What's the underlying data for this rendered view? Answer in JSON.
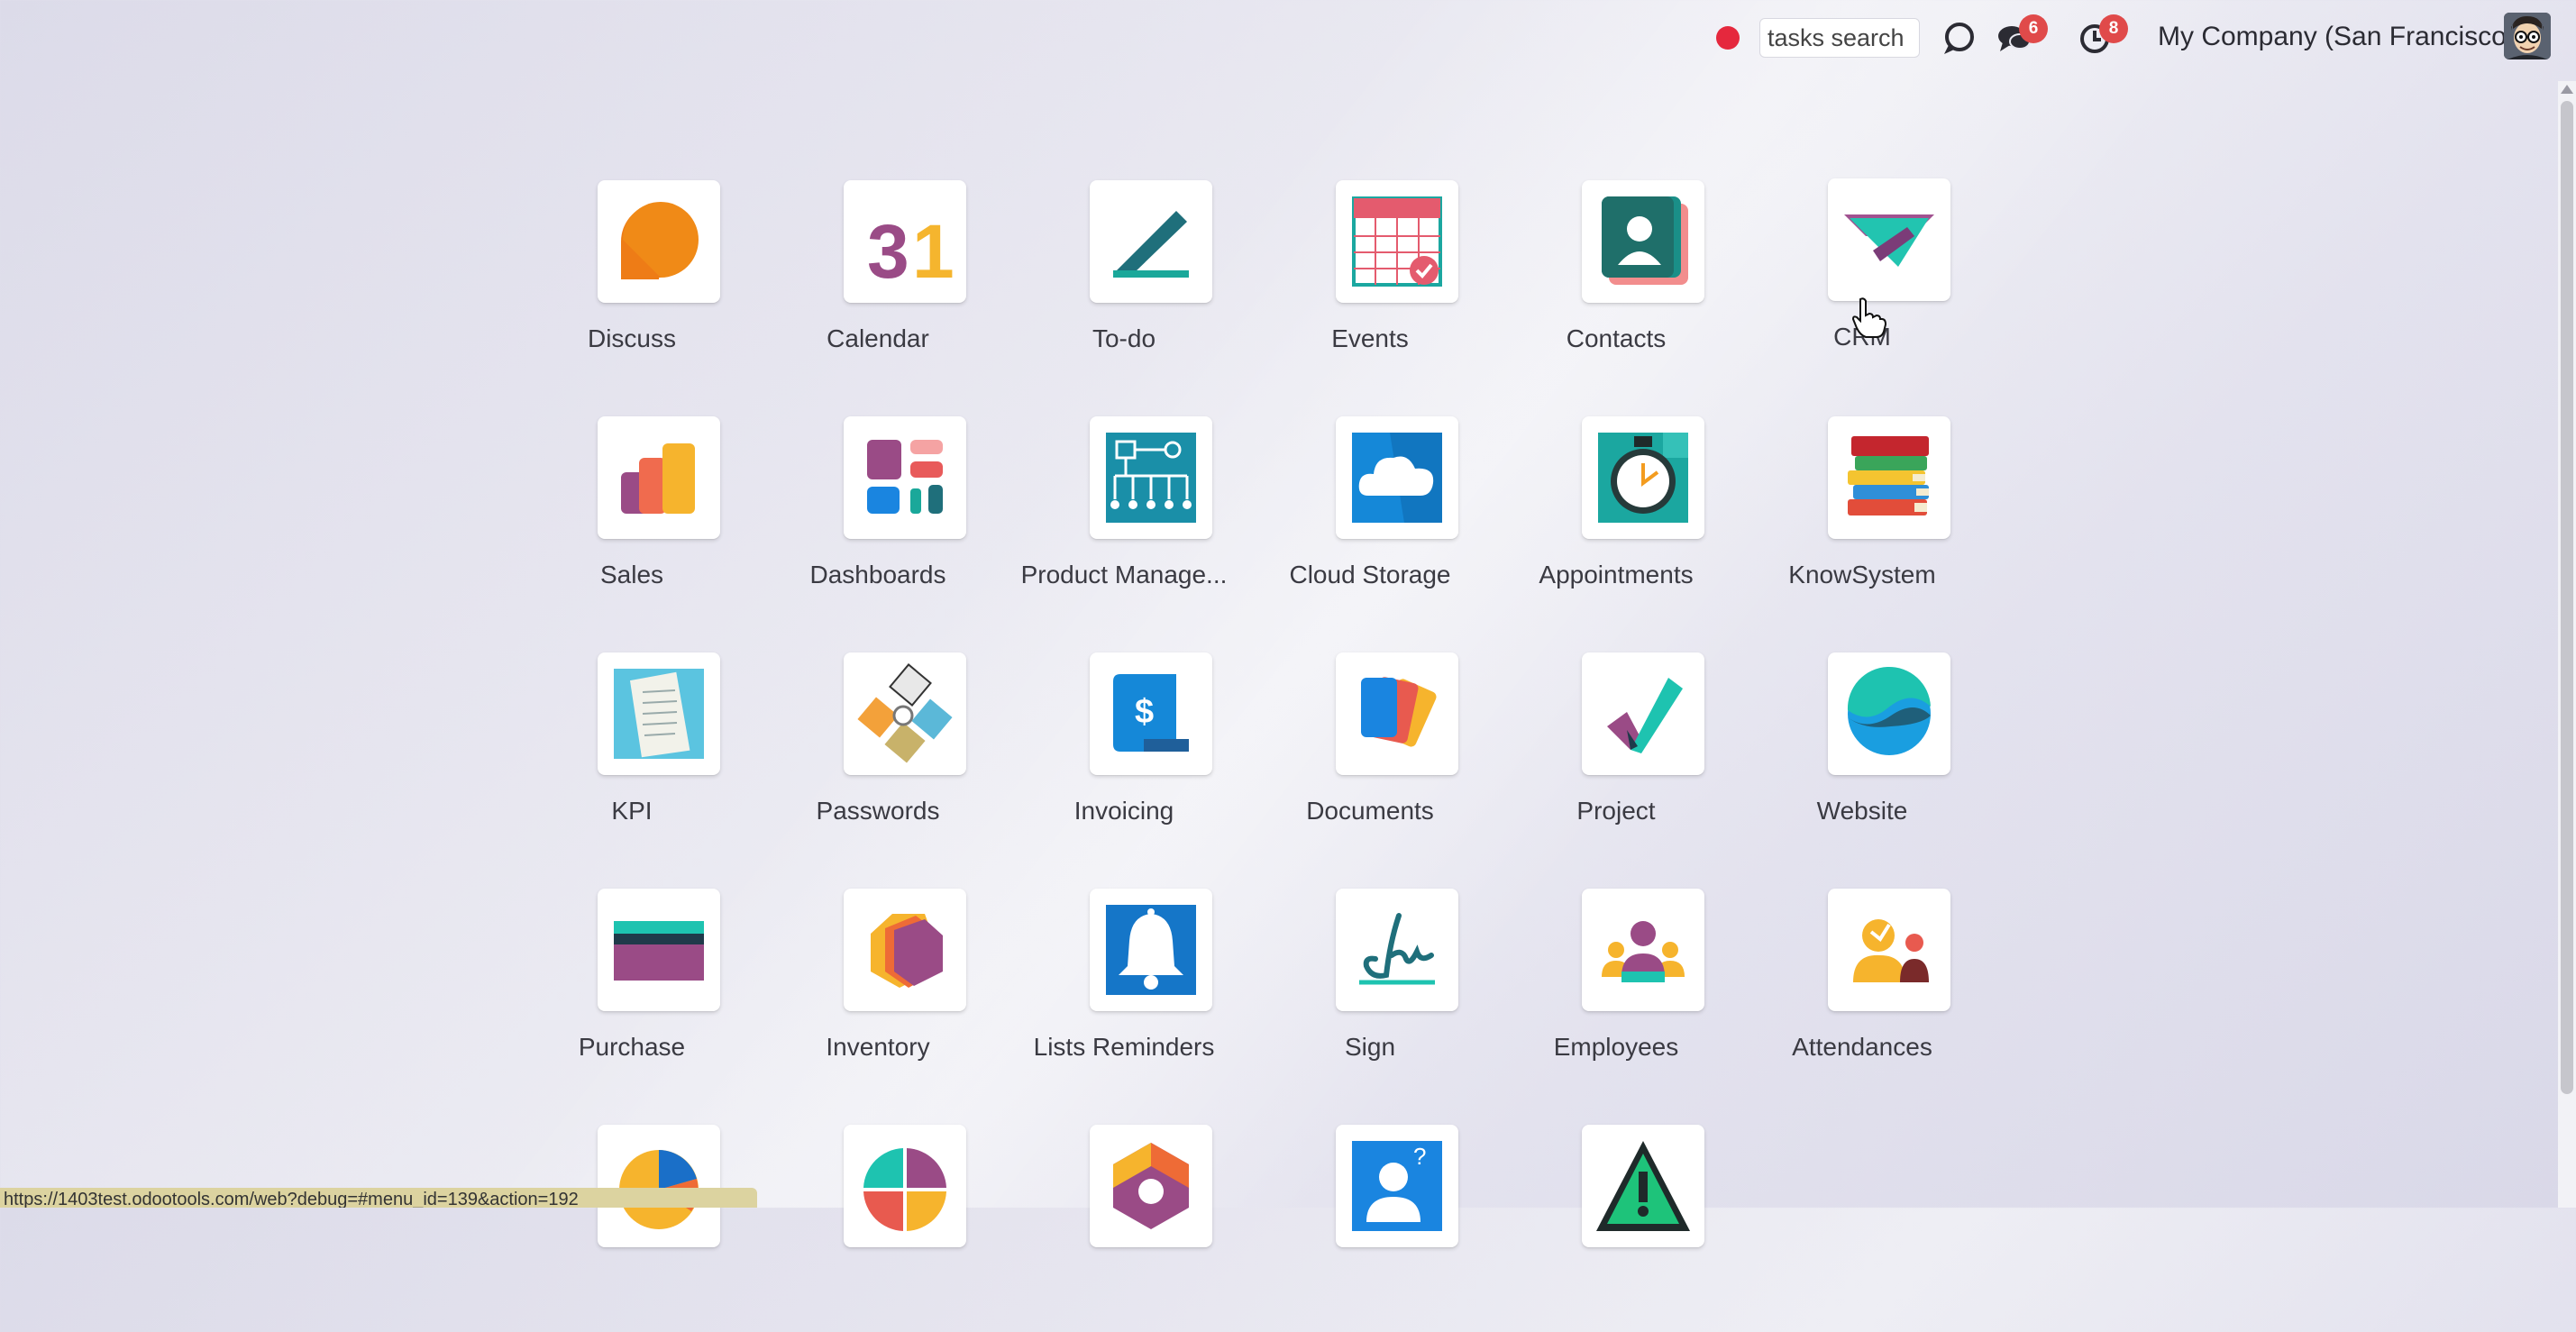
{
  "topbar": {
    "search_value": "tasks search",
    "messages_count": "6",
    "activities_count": "8",
    "company": "My Company (San Francisco)"
  },
  "apps": [
    {
      "label": "Discuss",
      "icon": "discuss-icon"
    },
    {
      "label": "Calendar",
      "icon": "calendar-icon"
    },
    {
      "label": "To-do",
      "icon": "todo-icon"
    },
    {
      "label": "Events",
      "icon": "events-icon"
    },
    {
      "label": "Contacts",
      "icon": "contacts-icon"
    },
    {
      "label": "CRM",
      "icon": "crm-icon"
    },
    {
      "label": "Sales",
      "icon": "sales-icon"
    },
    {
      "label": "Dashboards",
      "icon": "dashboards-icon"
    },
    {
      "label": "Product Manage...",
      "icon": "product-management-icon"
    },
    {
      "label": "Cloud Storage",
      "icon": "cloud-storage-icon"
    },
    {
      "label": "Appointments",
      "icon": "appointments-icon"
    },
    {
      "label": "KnowSystem",
      "icon": "knowsystem-icon"
    },
    {
      "label": "KPI",
      "icon": "kpi-icon"
    },
    {
      "label": "Passwords",
      "icon": "passwords-icon"
    },
    {
      "label": "Invoicing",
      "icon": "invoicing-icon"
    },
    {
      "label": "Documents",
      "icon": "documents-icon"
    },
    {
      "label": "Project",
      "icon": "project-icon"
    },
    {
      "label": "Website",
      "icon": "website-icon"
    },
    {
      "label": "Purchase",
      "icon": "purchase-icon"
    },
    {
      "label": "Inventory",
      "icon": "inventory-icon"
    },
    {
      "label": "Lists Reminders",
      "icon": "lists-reminders-icon"
    },
    {
      "label": "Sign",
      "icon": "sign-icon"
    },
    {
      "label": "Employees",
      "icon": "employees-icon"
    },
    {
      "label": "Attendances",
      "icon": "attendances-icon"
    }
  ],
  "status_url": "https://1403test.odootools.com/web?debug=#menu_id=139&action=192"
}
